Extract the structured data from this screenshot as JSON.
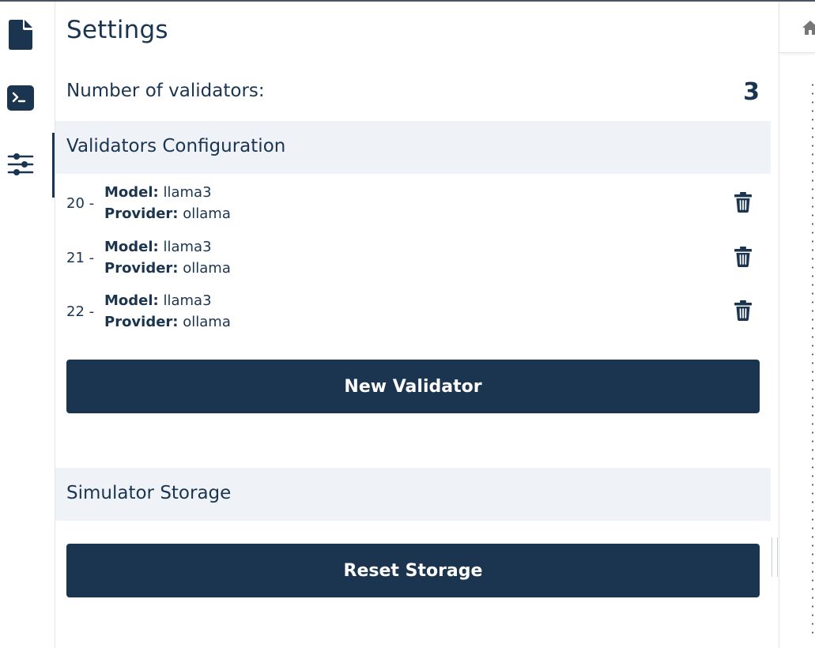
{
  "sidebar": {
    "items": [
      {
        "icon": "file-icon",
        "active": false
      },
      {
        "icon": "terminal-icon",
        "active": false
      },
      {
        "icon": "sliders-icon",
        "active": true
      }
    ]
  },
  "settings": {
    "title": "Settings",
    "validator_count_label": "Number of validators:",
    "validator_count": "3",
    "validators_section_title": "Validators Configuration",
    "model_label": "Model:",
    "provider_label": "Provider:",
    "validators": [
      {
        "number": "20 -",
        "model": "llama3",
        "provider": "ollama"
      },
      {
        "number": "21 -",
        "model": "llama3",
        "provider": "ollama"
      },
      {
        "number": "22 -",
        "model": "llama3",
        "provider": "ollama"
      }
    ],
    "new_validator_label": "New Validator",
    "storage_section_title": "Simulator Storage",
    "reset_storage_label": "Reset Storage"
  },
  "colors": {
    "primary": "#1b3550",
    "section_bg": "#eff3f8",
    "divider": "#e3e6ea"
  }
}
